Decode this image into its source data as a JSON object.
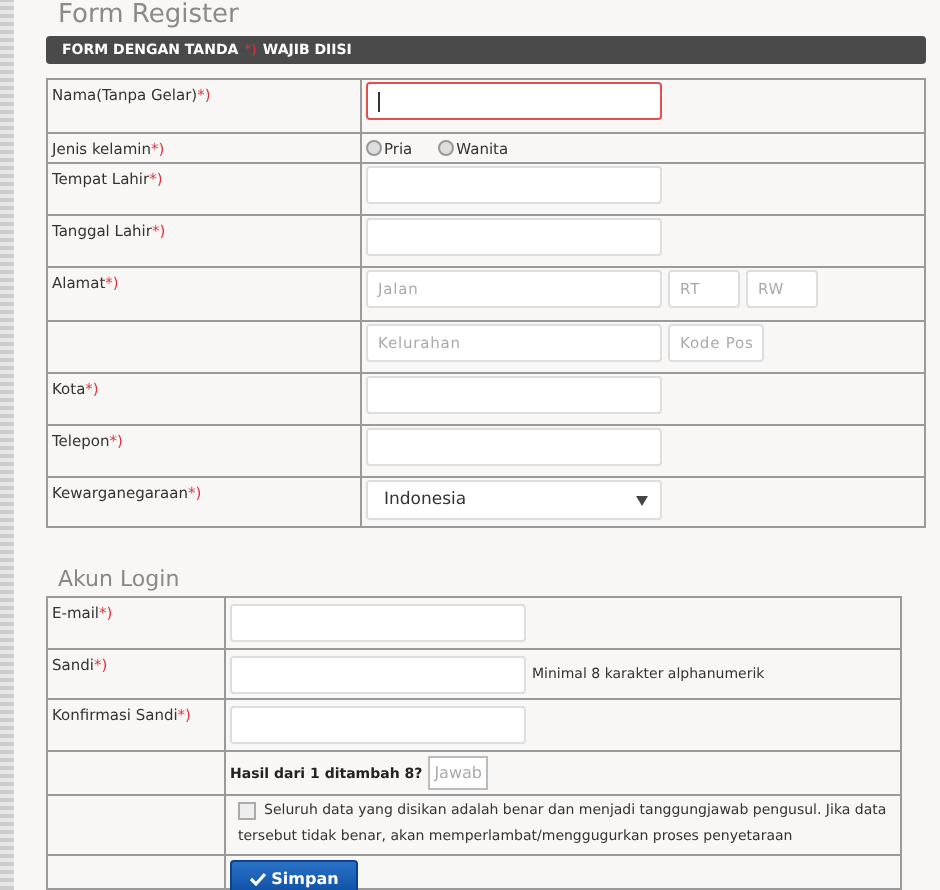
{
  "title": "Form Register",
  "notice": {
    "before": "FORM DENGAN TANDA",
    "mark": "*)",
    "after": "WAJIB DIISI"
  },
  "personal_rows": [
    {
      "kind": "text",
      "label": "Nama(Tanpa Gelar)",
      "mark": "*)",
      "focused": true
    },
    {
      "kind": "radio",
      "label": "Jenis kelamin",
      "mark": "*)",
      "options": [
        {
          "label": "Pria",
          "selected": false
        },
        {
          "label": "Wanita",
          "selected": false
        }
      ]
    },
    {
      "kind": "text",
      "label": "Tempat Lahir",
      "mark": "*)",
      "focused": false
    },
    {
      "kind": "text",
      "label": "Tanggal Lahir",
      "mark": "*)",
      "focused": false
    },
    {
      "kind": "multi",
      "label": "Alamat",
      "mark": "*)",
      "fields": [
        {
          "placeholder": "Jalan"
        },
        {
          "placeholder": "RT"
        },
        {
          "placeholder": "RW"
        }
      ]
    },
    {
      "kind": "multi",
      "fields": [
        {
          "placeholder": "Kelurahan"
        },
        {
          "placeholder": "Kode Pos"
        }
      ]
    },
    {
      "kind": "text",
      "label": "Kota",
      "mark": "*)",
      "focused": false
    },
    {
      "kind": "text",
      "label": "Telepon",
      "mark": "*)",
      "focused": false
    },
    {
      "kind": "select",
      "label": "Kewarganegaraan",
      "mark": "*)",
      "value": "Indonesia"
    }
  ],
  "login_title": "Akun Login",
  "login_rows": [
    {
      "kind": "text",
      "label": "E-mail",
      "mark": "*)"
    },
    {
      "kind": "text",
      "label": "Sandi",
      "mark": "*)",
      "hint": "Minimal 8 karakter alphanumerik"
    },
    {
      "kind": "text",
      "label": "Konfirmasi Sandi",
      "mark": "*)"
    },
    {
      "kind": "captcha",
      "question": "Hasil dari 1 ditambah 8?",
      "placeholder": "Jawab"
    },
    {
      "kind": "agree",
      "checked": false,
      "text": "Seluruh data yang disikan adalah benar dan menjadi tanggungjawab pengusul. Jika data tersebut tidak benar, akan memperlambat/menggugurkan proses penyetaraan"
    },
    {
      "kind": "submit",
      "button": "Simpan"
    }
  ]
}
